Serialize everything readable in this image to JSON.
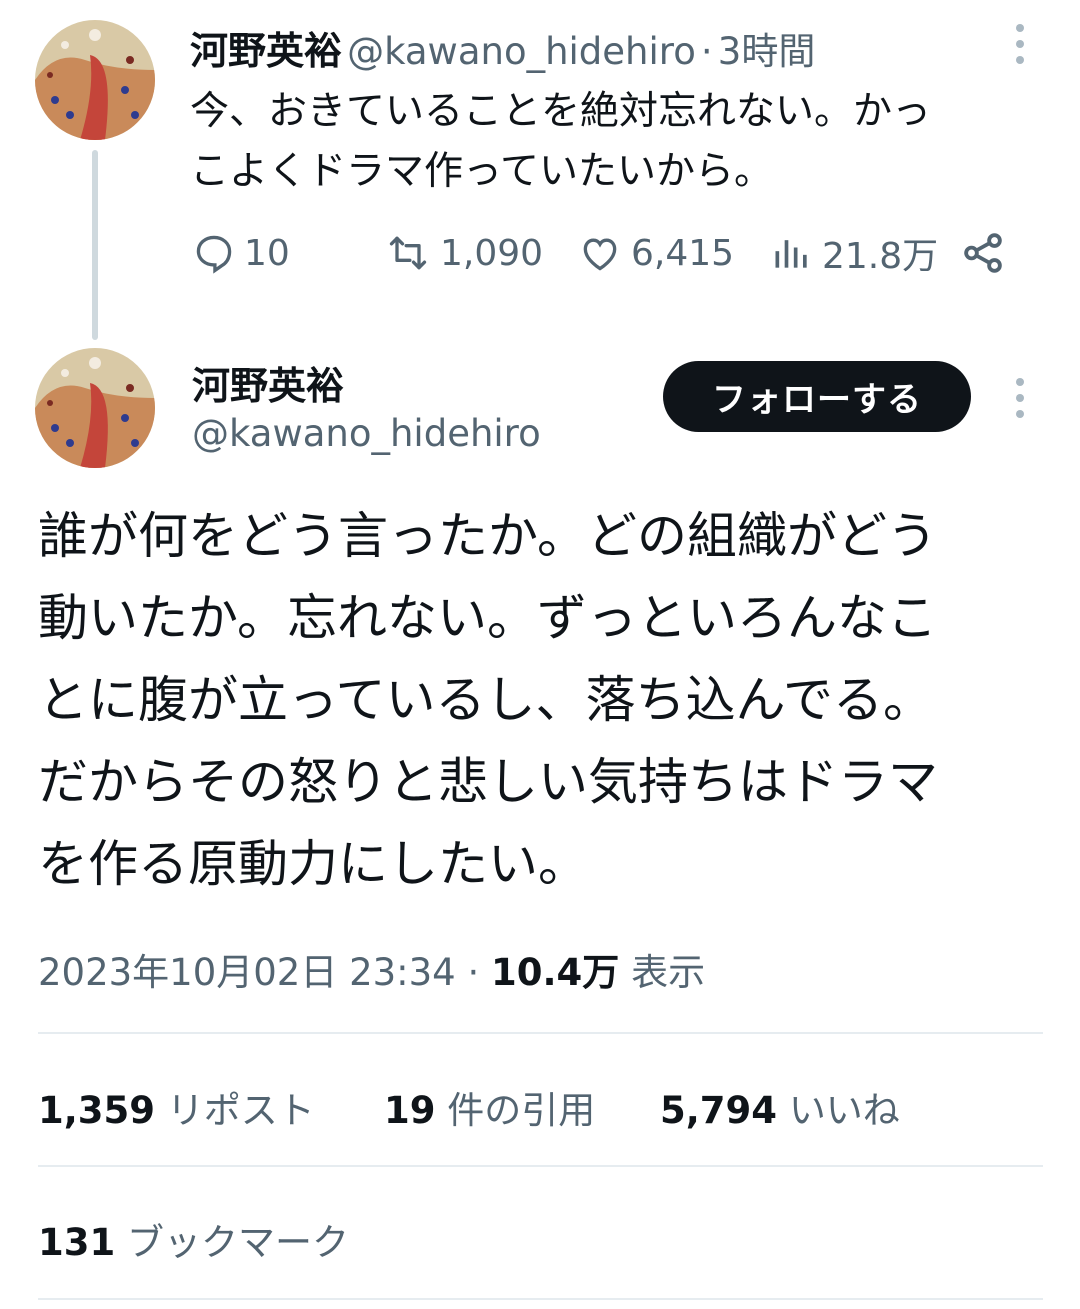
{
  "parent_post": {
    "author_name": "河野英裕",
    "handle": "@kawano_hidehiro",
    "separator": "·",
    "time": "3時間",
    "text_line1": "今、おきていることを絶対忘れない。かっ",
    "text_line2": "こよくドラマ作っていたいから。",
    "replies": "10",
    "reposts": "1,090",
    "likes": "6,415",
    "views": "21.8万"
  },
  "main_post": {
    "author_name": "河野英裕",
    "handle": "@kawano_hidehiro",
    "follow_label": "フォローする",
    "text_lines": [
      "誰が何をどう言ったか。どの組織がどう",
      "動いたか。忘れない。ずっといろんなこ",
      "とに腹が立っているし、落ち込んでる。",
      "だからその怒りと悲しい気持ちはドラマ",
      "を作る原動力にしたい。"
    ],
    "timestamp": "2023年10月02日 23:34",
    "dot": "·",
    "view_count": "10.4万",
    "view_label": "表示"
  },
  "engagement": {
    "reposts_count": "1,359",
    "reposts_label": "リポスト",
    "quotes_count": "19",
    "quotes_label": "件の引用",
    "likes_count": "5,794",
    "likes_label": "いいね",
    "bookmarks_count": "131",
    "bookmarks_label": "ブックマーク"
  },
  "colors": {
    "text": "#0f1419",
    "secondary": "#536471",
    "divider": "#e6ecf0",
    "follow_bg": "#0f1419"
  },
  "icons": [
    "reply-icon",
    "repost-icon",
    "like-icon",
    "views-icon",
    "share-icon",
    "more-icon"
  ]
}
